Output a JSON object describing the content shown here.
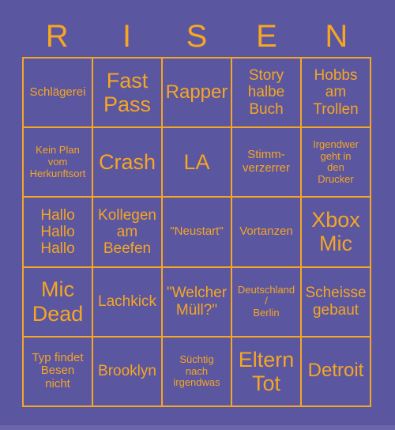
{
  "card": {
    "title": "RISEN",
    "title_letters": [
      "R",
      "I",
      "S",
      "E",
      "N"
    ],
    "colors": {
      "background": "#5b56a0",
      "accent": "#f5a623",
      "bottom_strip": "#6b66ab"
    },
    "grid": {
      "columns": 5,
      "rows": 5,
      "cells": [
        {
          "text": "Schlägerei",
          "size": "sm"
        },
        {
          "text": "Fast\nPass",
          "size": "xl"
        },
        {
          "text": "Rapper",
          "size": "lg"
        },
        {
          "text": "Story\nhalbe\nBuch",
          "size": "md"
        },
        {
          "text": "Hobbs\nam\nTrollen",
          "size": "md"
        },
        {
          "text": "Kein Plan\nvom\nHerkunftsort",
          "size": "xs"
        },
        {
          "text": "Crash",
          "size": "xl"
        },
        {
          "text": "LA",
          "size": "xl"
        },
        {
          "text": "Stimm-\nverzerrer",
          "size": "sm"
        },
        {
          "text": "Irgendwer\ngeht in\nden\nDrucker",
          "size": "xs"
        },
        {
          "text": "Hallo\nHallo\nHallo",
          "size": "md"
        },
        {
          "text": "Kollegen\nam\nBeefen",
          "size": "md"
        },
        {
          "text": "\"Neustart\"",
          "size": "sm"
        },
        {
          "text": "Vortanzen",
          "size": "sm"
        },
        {
          "text": "Xbox\nMic",
          "size": "xl"
        },
        {
          "text": "Mic\nDead",
          "size": "xl"
        },
        {
          "text": "Lachkick",
          "size": "md"
        },
        {
          "text": "\"Welcher\nMüll?\"",
          "size": "md"
        },
        {
          "text": "Deutschland\n/\nBerlin",
          "size": "xs"
        },
        {
          "text": "Scheisse\ngebaut",
          "size": "md"
        },
        {
          "text": "Typ findet\nBesen\nnicht",
          "size": "sm"
        },
        {
          "text": "Brooklyn",
          "size": "md"
        },
        {
          "text": "Süchtig\nnach\nirgendwas",
          "size": "xs"
        },
        {
          "text": "Eltern\nTot",
          "size": "xl"
        },
        {
          "text": "Detroit",
          "size": "lg"
        }
      ]
    }
  }
}
